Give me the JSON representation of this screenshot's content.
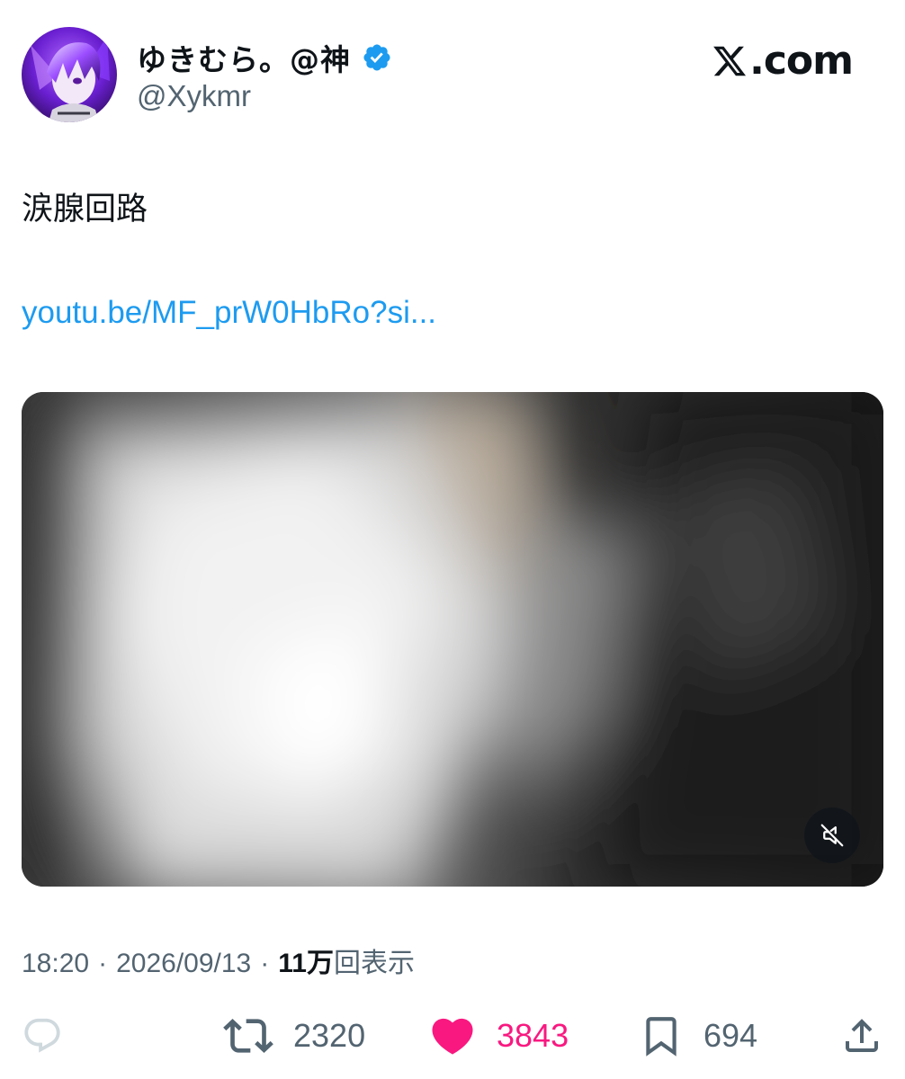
{
  "author": {
    "display_name": "ゆきむら。@神",
    "handle": "@Xykmr",
    "verified": true,
    "avatar": "avatar-image"
  },
  "brand": {
    "logo_icon": "x-logo-icon",
    "logo_text": ".com"
  },
  "tweet": {
    "text": "涙腺回路",
    "link": "youtu.be/MF_prW0HbRo?si..."
  },
  "media": {
    "type": "video-thumbnail",
    "mute_icon": "speaker-muted-icon"
  },
  "meta": {
    "time": "18:20",
    "separator": "·",
    "date": "2026/09/13",
    "views_count": "11万",
    "views_label": "回表示"
  },
  "actions": {
    "reply": {
      "icon": "reply-icon",
      "count": ""
    },
    "retweet": {
      "icon": "retweet-icon",
      "count": "2320"
    },
    "like": {
      "icon": "heart-icon",
      "count": "3843",
      "liked": true
    },
    "bookmark": {
      "icon": "bookmark-icon",
      "count": "694"
    },
    "share": {
      "icon": "share-icon"
    }
  },
  "colors": {
    "link": "#1d9bf0",
    "verified": "#1d9bf0",
    "like": "#f91880",
    "secondary_text": "#536471",
    "primary_text": "#0f1419"
  }
}
